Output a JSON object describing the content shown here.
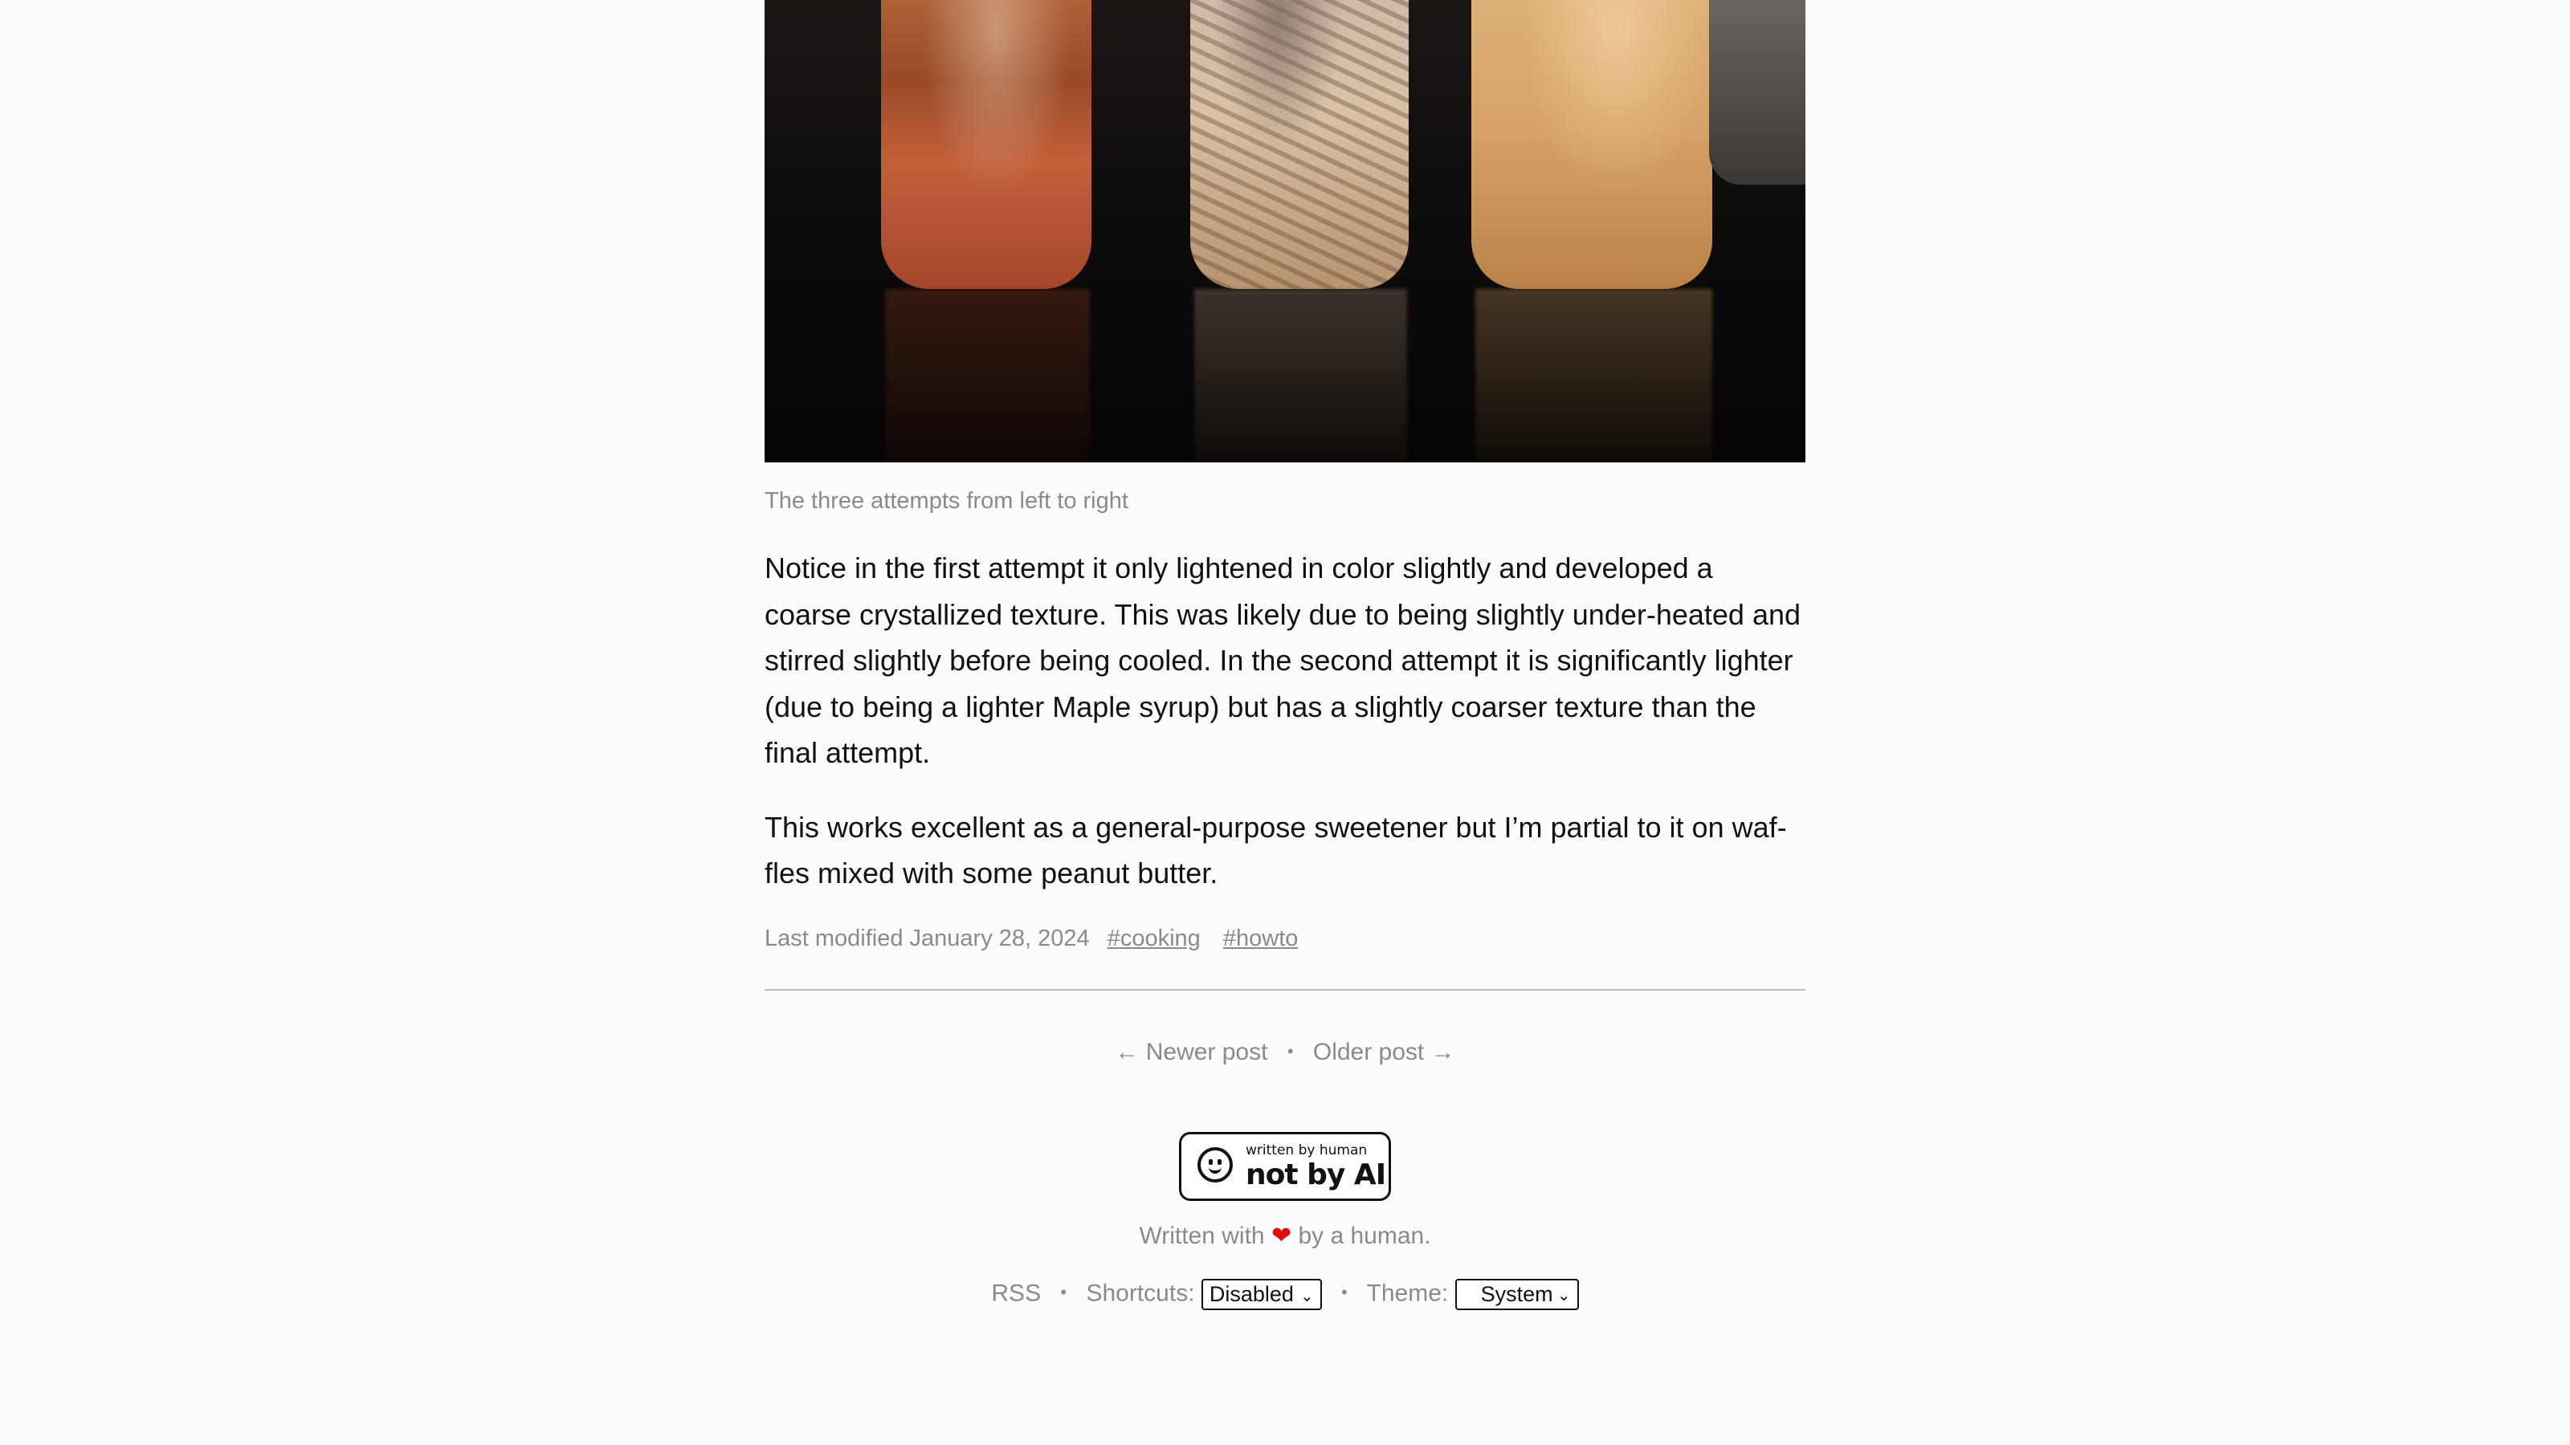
{
  "figure": {
    "image_alt": "Three mason jars of maple syrup attempts on a dark stovetop",
    "caption": "The three attempts from left to right"
  },
  "article": {
    "paragraphs": [
      "Notice in the first attempt it only lightened in color slightly and developed a coarse crystallized texture. This was likely due to being slightly under-heated and stirred slightly before being cooled. In the second attempt it is significantly lighter (due to being a lighter Maple syrup) but has a slightly coarser texture than the final attempt.",
      "This works excellent as a general-purpose sweetener but I’m partial to it on waf­fles mixed with some peanut butter."
    ]
  },
  "meta": {
    "last_modified": "Last modified January 28, 2024",
    "tags": [
      "#cooking",
      "#howto"
    ]
  },
  "post_nav": {
    "newer": "← Newer post",
    "separator": "•",
    "older": "Older post →"
  },
  "badge": {
    "small": "written by human",
    "big": "not by AI"
  },
  "written": {
    "prefix": "Written with",
    "heart": "❤",
    "suffix": "by a human."
  },
  "footer": {
    "rss": "RSS",
    "separator": "•",
    "shortcuts_label": "Shortcuts:",
    "shortcuts_value": "Disabled",
    "theme_label": "Theme:",
    "theme_value": "System"
  }
}
